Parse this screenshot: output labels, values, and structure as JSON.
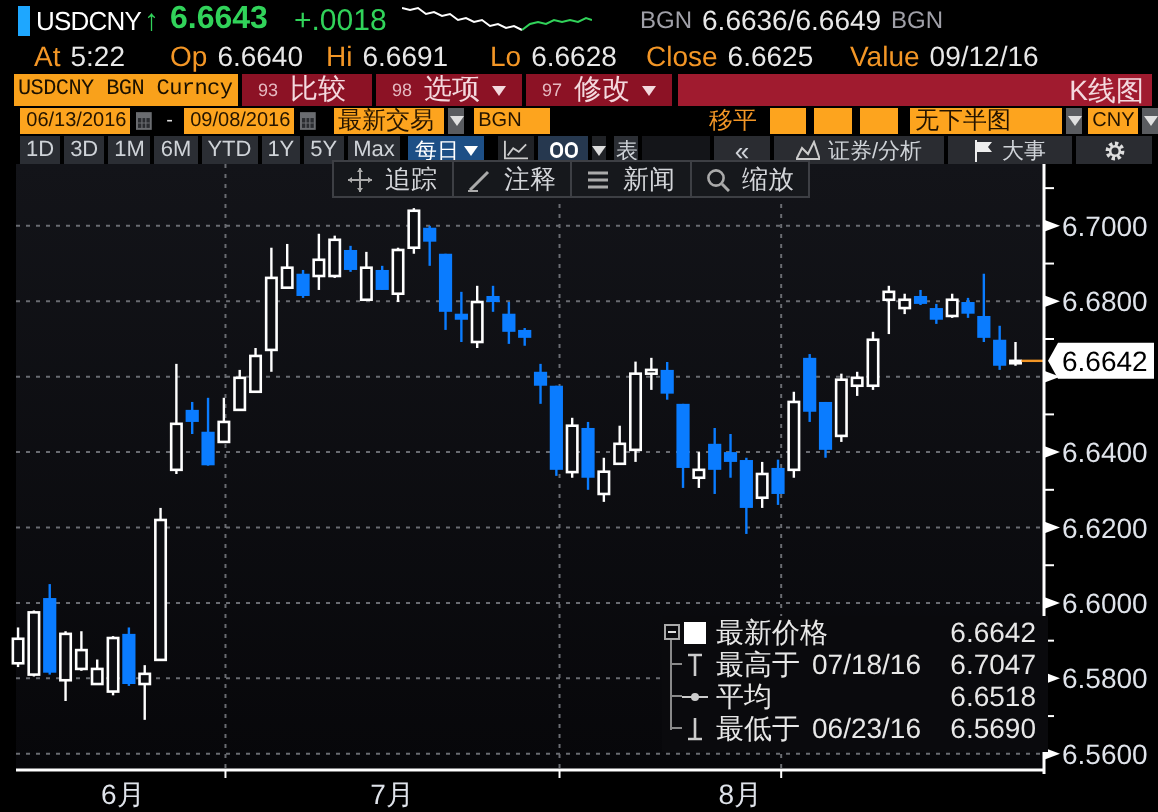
{
  "quote": {
    "ticker": "USDCNY",
    "arrow": "↑",
    "last": "6.6643",
    "change": "+.0018",
    "bid_source": "BGN",
    "bid_ask": "6.6636/6.6649",
    "ask_source": "BGN"
  },
  "stats": [
    {
      "label": "At",
      "value": "5:22"
    },
    {
      "label": "Op",
      "value": "6.6640"
    },
    {
      "label": "Hi",
      "value": "6.6691"
    },
    {
      "label": "Lo",
      "value": "6.6628"
    },
    {
      "label": "Close",
      "value": "6.6625"
    },
    {
      "label": "Value",
      "value": "09/12/16"
    }
  ],
  "command_bar": {
    "security": "USDCNY BGN Curncy",
    "buttons": [
      {
        "number": "93",
        "label": "比较",
        "dropdown": false
      },
      {
        "number": "98",
        "label": "选项",
        "dropdown": true
      },
      {
        "number": "97",
        "label": "修改",
        "dropdown": true
      }
    ],
    "title": "K线图"
  },
  "range": {
    "start": "06/13/2016",
    "separator": "-",
    "end": "09/08/2016",
    "field": "最新交易",
    "source": "BGN",
    "smoothing_label": "移平",
    "lower_chart": "无下半图",
    "currency": "CNY"
  },
  "periods": [
    {
      "label": "1D",
      "selected": false
    },
    {
      "label": "3D",
      "selected": false
    },
    {
      "label": "1M",
      "selected": false
    },
    {
      "label": "6M",
      "selected": false
    },
    {
      "label": "YTD",
      "selected": false
    },
    {
      "label": "1Y",
      "selected": false
    },
    {
      "label": "5Y",
      "selected": false
    },
    {
      "label": "Max",
      "selected": false
    }
  ],
  "frequency": "每日",
  "table_button": "表",
  "right_tools": [
    {
      "kind": "collapse",
      "label": "«"
    },
    {
      "kind": "analysis",
      "label": "证券/分析"
    },
    {
      "kind": "events",
      "label": "大事"
    },
    {
      "kind": "settings"
    }
  ],
  "chart_tools": [
    {
      "kind": "track",
      "label": "追踪"
    },
    {
      "kind": "annotate",
      "label": "注释"
    },
    {
      "kind": "news",
      "label": "新闻"
    },
    {
      "kind": "zoom",
      "label": "缩放"
    }
  ],
  "chart": {
    "last_price": "6.6642",
    "chart_data": {
      "type": "candlestick",
      "grid": true,
      "ylim": [
        6.5557,
        6.7164
      ],
      "yticks": [
        {
          "value": 6.56,
          "label": "6.5600"
        },
        {
          "value": 6.58,
          "label": "6.5800"
        },
        {
          "value": 6.6,
          "label": "6.6000"
        },
        {
          "value": 6.62,
          "label": "6.6200"
        },
        {
          "value": 6.64,
          "label": "6.6400"
        },
        {
          "value": 6.68,
          "label": "6.6800"
        },
        {
          "value": 6.7,
          "label": "6.7000"
        }
      ],
      "categories": [
        null,
        null,
        null,
        null,
        null,
        null,
        null,
        "6月",
        null,
        null,
        null,
        null,
        null,
        null,
        null,
        null,
        null,
        null,
        null,
        null,
        null,
        null,
        null,
        null,
        "7月",
        null,
        null,
        null,
        null,
        null,
        null,
        null,
        null,
        null,
        null,
        null,
        null,
        null,
        null,
        null,
        null,
        null,
        null,
        null,
        null,
        null,
        "8月",
        null,
        null,
        null,
        null,
        null,
        null,
        null,
        null,
        null,
        null,
        null,
        null,
        null,
        null,
        null,
        null,
        null
      ],
      "ohlc": [
        [
          6.584,
          6.5935,
          6.583,
          6.5905
        ],
        [
          6.581,
          6.598,
          6.5805,
          6.5975
        ],
        [
          6.6013,
          6.605,
          6.581,
          6.5815
        ],
        [
          6.5795,
          6.5925,
          6.574,
          6.5918
        ],
        [
          6.5825,
          6.5925,
          6.582,
          6.5875
        ],
        [
          6.5785,
          6.585,
          6.5785,
          6.5825
        ],
        [
          6.5765,
          6.5912,
          6.5755,
          6.5907
        ],
        [
          6.5918,
          6.5935,
          6.578,
          6.5785
        ],
        [
          6.5785,
          6.5835,
          6.569,
          6.5812
        ],
        [
          6.5849,
          6.6252,
          6.5849,
          6.622
        ],
        [
          6.6353,
          6.6634,
          6.6342,
          6.6475
        ],
        [
          6.6512,
          6.6533,
          6.6448,
          6.648
        ],
        [
          6.6454,
          6.6544,
          6.6364,
          6.6365
        ],
        [
          6.6427,
          6.6544,
          6.6427,
          6.648
        ],
        [
          6.6512,
          6.6618,
          6.6512,
          6.6597
        ],
        [
          6.656,
          6.6676,
          6.656,
          6.6655
        ],
        [
          6.6671,
          6.6942,
          6.6613,
          6.6862
        ],
        [
          6.6836,
          6.6952,
          6.6836,
          6.6889
        ],
        [
          6.6873,
          6.6883,
          6.6809,
          6.6814
        ],
        [
          6.6867,
          6.6979,
          6.683,
          6.691
        ],
        [
          6.6867,
          6.6974,
          6.6862,
          6.6963
        ],
        [
          6.6936,
          6.6947,
          6.6878,
          6.6883
        ],
        [
          6.6804,
          6.6931,
          6.6804,
          6.6889
        ],
        [
          6.6883,
          6.6894,
          6.683,
          6.683
        ],
        [
          6.682,
          6.6942,
          6.6798,
          6.6936
        ],
        [
          6.6942,
          6.7047,
          6.6926,
          6.704
        ],
        [
          6.6995,
          6.7,
          6.6894,
          6.6958
        ],
        [
          6.6926,
          6.6926,
          6.6724,
          6.6772
        ],
        [
          6.6767,
          6.6825,
          6.6692,
          6.6751
        ],
        [
          6.6692,
          6.6841,
          6.6676,
          6.6798
        ],
        [
          6.6814,
          6.6841,
          6.6772,
          6.6798
        ],
        [
          6.6767,
          6.6798,
          6.6687,
          6.6719
        ],
        [
          6.6724,
          6.6729,
          6.6682,
          6.6703
        ],
        [
          6.6613,
          6.6634,
          6.6528,
          6.6576
        ],
        [
          6.6576,
          6.6576,
          6.6337,
          6.6353
        ],
        [
          6.6347,
          6.6491,
          6.6332,
          6.647
        ],
        [
          6.6464,
          6.648,
          6.63,
          6.6332
        ],
        [
          6.6289,
          6.6385,
          6.6268,
          6.6348
        ],
        [
          6.6369,
          6.647,
          6.6369,
          6.6422
        ],
        [
          6.6406,
          6.664,
          6.6374,
          6.6608
        ],
        [
          6.6608,
          6.665,
          6.6565,
          6.6618
        ],
        [
          6.6618,
          6.6639,
          6.6539,
          6.6555
        ],
        [
          6.6528,
          6.6528,
          6.6305,
          6.6358
        ],
        [
          6.6332,
          6.64,
          6.6305,
          6.6353
        ],
        [
          6.6422,
          6.6464,
          6.6289,
          6.6353
        ],
        [
          6.64,
          6.6448,
          6.6332,
          6.6374
        ],
        [
          6.6379,
          6.6385,
          6.6183,
          6.6252
        ],
        [
          6.6279,
          6.6374,
          6.6252,
          6.6342
        ],
        [
          6.6358,
          6.638,
          6.626,
          6.6289
        ],
        [
          6.6353,
          6.656,
          6.6332,
          6.6533
        ],
        [
          6.665,
          6.666,
          6.648,
          6.6507
        ],
        [
          6.6533,
          6.6533,
          6.6385,
          6.6406
        ],
        [
          6.6443,
          6.6608,
          6.6427,
          6.6592
        ],
        [
          6.6576,
          6.6613,
          6.6549,
          6.6597
        ],
        [
          6.6576,
          6.6719,
          6.6565,
          6.6698
        ],
        [
          6.6804,
          6.6841,
          6.6713,
          6.6825
        ],
        [
          6.6782,
          6.682,
          6.6766,
          6.6804
        ],
        [
          6.6814,
          6.683,
          6.679,
          6.6793
        ],
        [
          6.6782,
          6.6793,
          6.674,
          6.6751
        ],
        [
          6.6761,
          6.682,
          6.6756,
          6.6804
        ],
        [
          6.6798,
          6.6809,
          6.6756,
          6.6767
        ],
        [
          6.6761,
          6.6873,
          6.6692,
          6.6703
        ],
        [
          6.6698,
          6.6735,
          6.6618,
          6.6629
        ],
        [
          6.664,
          6.6692,
          6.6629,
          6.6642
        ]
      ]
    },
    "legend": {
      "expanded": true,
      "rows": [
        {
          "kind": "last",
          "label": "最新价格",
          "value": "6.6642"
        },
        {
          "kind": "high",
          "label": "最高于",
          "date": "07/18/16",
          "value": "6.7047"
        },
        {
          "kind": "average",
          "label": "平均",
          "value": "6.6518"
        },
        {
          "kind": "low",
          "label": "最低于",
          "date": "06/23/16",
          "value": "6.5690"
        }
      ]
    }
  }
}
